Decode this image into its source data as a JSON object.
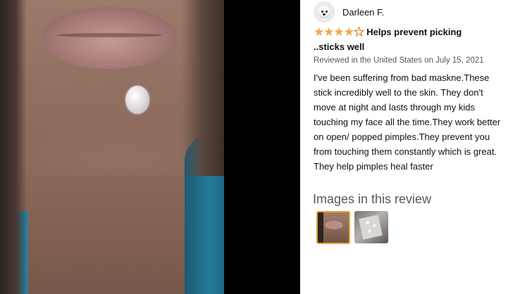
{
  "reviewer": {
    "name": "Darleen F."
  },
  "rating": {
    "stars_filled": 4,
    "stars_total": 5
  },
  "review": {
    "title_line1": "Helps prevent picking",
    "title_line2": "..sticks well",
    "meta": "Reviewed in the United States on July 15, 2021",
    "body": "I've been suffering from bad maskne.These stick incredibly well to the skin. They don't move at night and lasts through my kids touching my face all the time.They work better on open/ popped pimples.They prevent you from touching them constantly which is great. They help pimples heal faster"
  },
  "images_section": {
    "title": "Images in this review"
  },
  "colors": {
    "star": "#f3a847",
    "selected_border": "#e3a33a"
  },
  "icons": [
    "avatar-dog-icon",
    "star-icon"
  ]
}
